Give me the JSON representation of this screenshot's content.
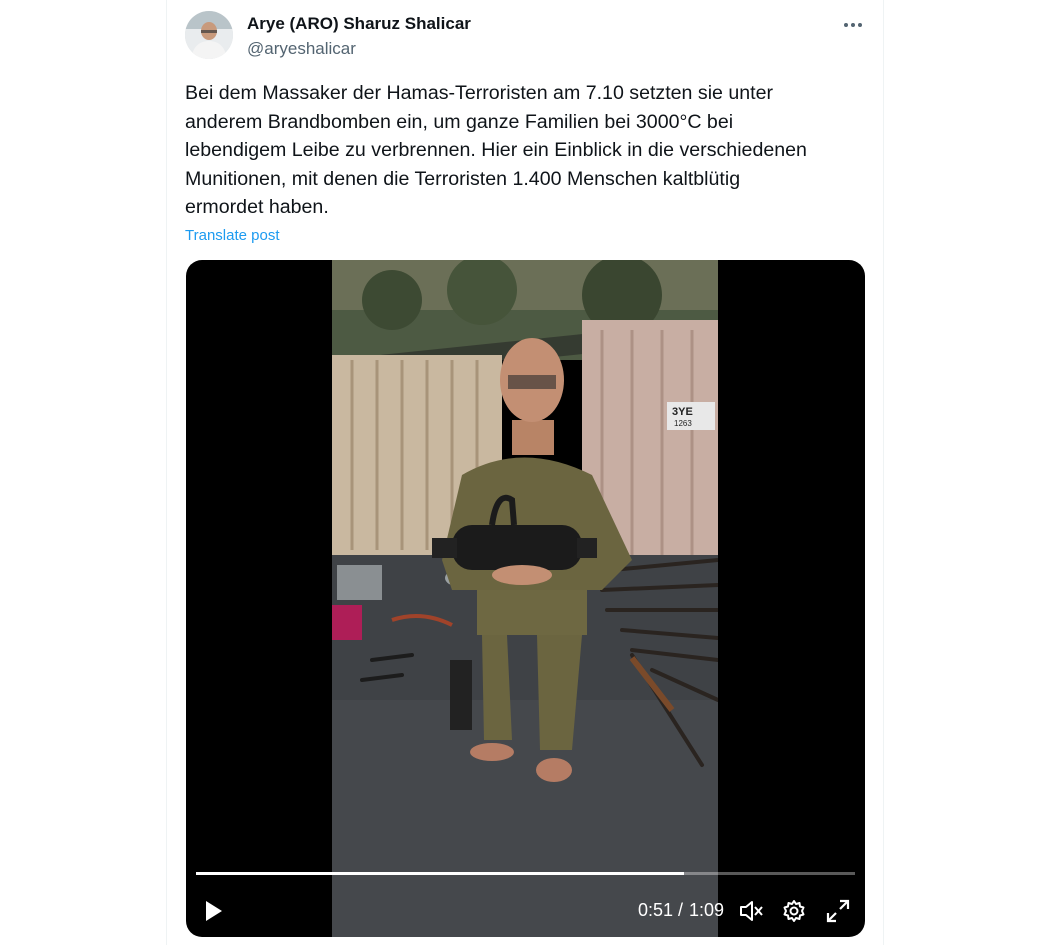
{
  "author": {
    "name": "Arye (ARO) Sharuz Shalicar",
    "handle": "@aryeshalicar"
  },
  "tweet": {
    "text": "Bei dem Massaker der Hamas-Terroristen am 7.10 setzten sie unter\nanderem Brandbomben ein, um ganze Familien bei 3000°C bei\nlebendigem Leibe zu verbrennen. Hier ein Einblick in die verschiedenen\nMunitionen, mit denen die Terroristen 1.400 Menschen kaltblütig\nermordet haben.",
    "translate_label": "Translate post"
  },
  "video": {
    "container_sign": "3YE",
    "container_sign_sub": "1263",
    "time_current": "0:51",
    "time_separator": "/",
    "time_total": "1:09",
    "progress": 0.74,
    "icons": {
      "play": "play-icon",
      "mute": "volume-muted-icon",
      "settings": "gear-icon",
      "fullscreen": "expand-icon"
    }
  },
  "colors": {
    "text": "#0f1419",
    "secondary": "#536471",
    "link": "#1d9bf0",
    "video_bg": "#000000"
  }
}
